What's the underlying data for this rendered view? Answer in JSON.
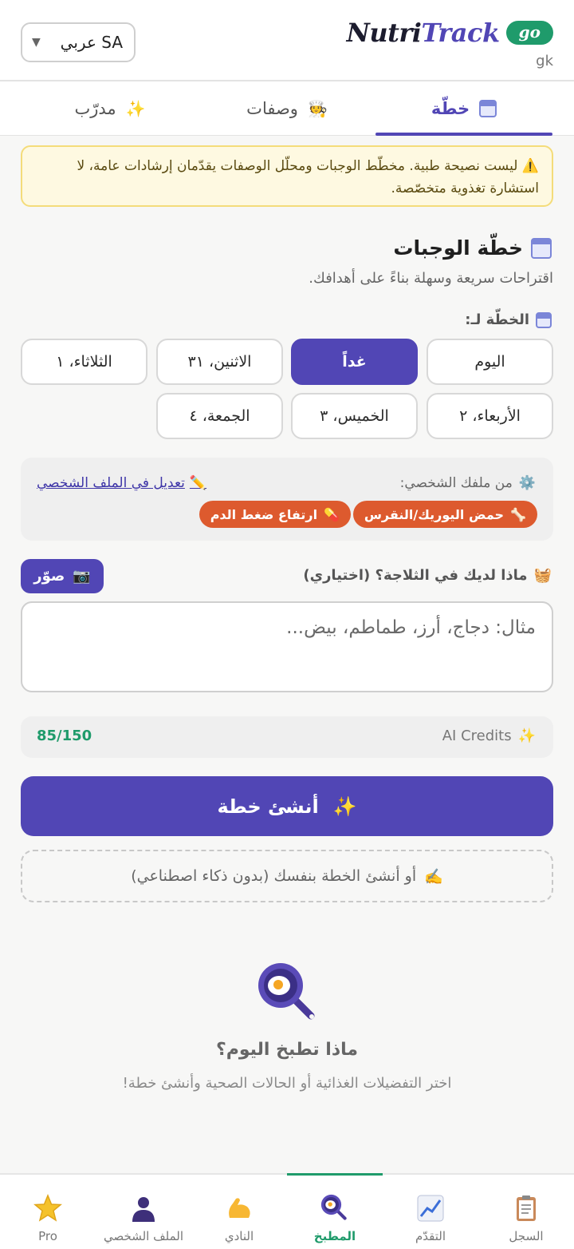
{
  "header": {
    "language_select": {
      "value": "عربي SA",
      "caret": "▼"
    },
    "brand": {
      "part1": "Nutri",
      "part2": "Track",
      "badge": "go"
    },
    "user_code": "gk"
  },
  "tabs": [
    {
      "label": "خطّة",
      "icon": "calendar-icon",
      "active": true
    },
    {
      "label": "وصفات",
      "icon": "chef-icon",
      "active": false
    },
    {
      "label": "مدرّب",
      "icon": "sparkles-icon",
      "active": false
    }
  ],
  "disclaimer": {
    "icon": "⚠️",
    "text": "ليست نصيحة طبية. مخطّط الوجبات ومحلّل الوصفات يقدّمان إرشادات عامة، لا استشارة تغذوية متخصّصة."
  },
  "meal_plan": {
    "title": "خطّة الوجبات",
    "subtitle": "اقتراحات سريعة وسهلة بناءً على أهدافك.",
    "plan_for_label": "الخطّة لـ:",
    "days": [
      "اليوم",
      "غداً",
      "الاثنين، ٣١",
      "الثلاثاء، ١",
      "الأربعاء، ٢",
      "الخميس، ٣",
      "الجمعة، ٤"
    ],
    "selected_day": "غداً"
  },
  "profile": {
    "label": "من ملفك الشخصي:",
    "edit_link": "تعديل في الملف الشخصي",
    "conditions": [
      {
        "label": "حمض اليوريك/النقرس",
        "icon": "bone-icon"
      },
      {
        "label": "ارتفاع ضغط الدم",
        "icon": "pill-icon"
      }
    ]
  },
  "fridge": {
    "label": "ماذا لديك في الثلاجة؟ (اختياري)",
    "photo_button": "صوّر",
    "placeholder": "مثال: دجاج، أرز، طماطم، بيض..."
  },
  "credits": {
    "label": "AI Credits",
    "value": "85/150"
  },
  "actions": {
    "create_plan": "أنشئ خطة",
    "manual_plan": "أو أنشئ الخطة بنفسك (بدون ذكاء اصطناعي)"
  },
  "empty_state": {
    "title": "ماذا تطبخ اليوم؟",
    "subtitle": "اختر التفضيلات الغذائية أو الحالات الصحية وأنشئ خطة!"
  },
  "bottom_nav": [
    {
      "label": "Pro",
      "icon": "star-icon"
    },
    {
      "label": "الملف الشخصي",
      "icon": "person-icon"
    },
    {
      "label": "النادي",
      "icon": "muscle-icon"
    },
    {
      "label": "المطبخ",
      "icon": "frying-pan-icon",
      "active": true
    },
    {
      "label": "التقدّم",
      "icon": "chart-icon"
    },
    {
      "label": "السجل",
      "icon": "clipboard-icon"
    }
  ],
  "colors": {
    "primary": "#5146b5",
    "accent_green": "#1f9b6b",
    "chip": "#dd5a2e",
    "warning_bg": "#fef9e1"
  }
}
